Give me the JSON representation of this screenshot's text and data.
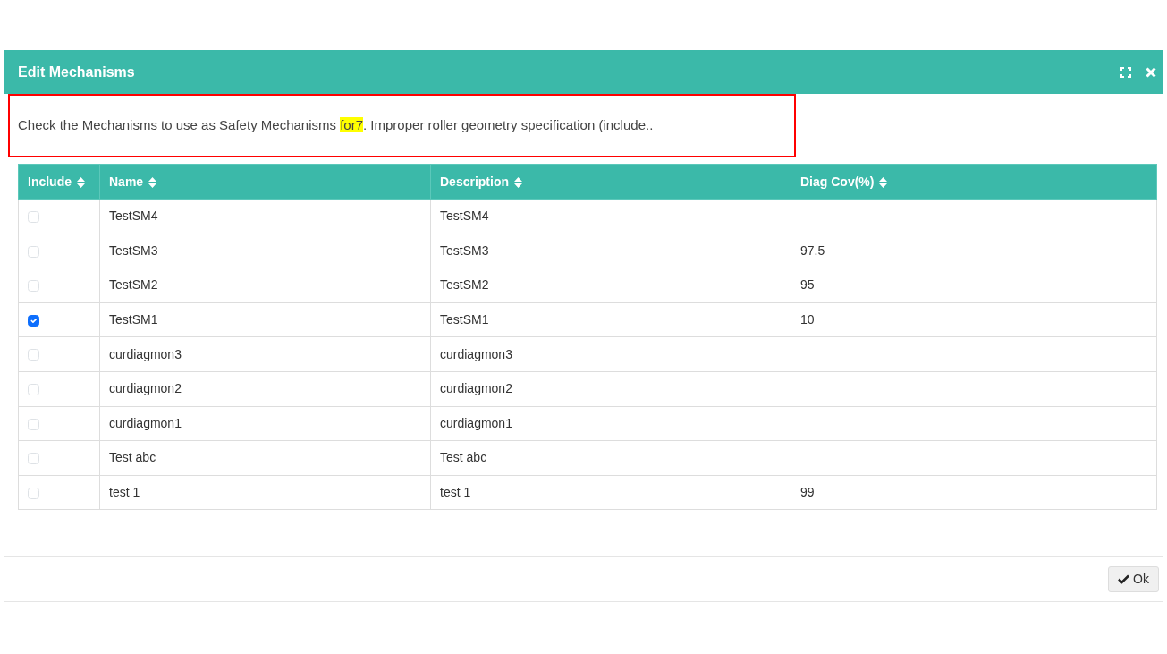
{
  "dialog": {
    "title": "Edit Mechanisms"
  },
  "message": [
    {
      "text": "Check the Mechanisms to use as Safety Mechanisms ",
      "highlighted": false
    },
    {
      "text": "for7",
      "highlighted": true
    },
    {
      "text": ". Improper roller geometry specification (include..",
      "highlighted": false
    }
  ],
  "table": {
    "columns": [
      "Include",
      "Name",
      "Description",
      "Diag Cov(%)"
    ],
    "rows": [
      {
        "checked": false,
        "name": "TestSM4",
        "description": "TestSM4",
        "diag_cov": ""
      },
      {
        "checked": false,
        "name": "TestSM3",
        "description": "TestSM3",
        "diag_cov": "97.5"
      },
      {
        "checked": false,
        "name": "TestSM2",
        "description": "TestSM2",
        "diag_cov": "95"
      },
      {
        "checked": true,
        "name": "TestSM1",
        "description": "TestSM1",
        "diag_cov": "10"
      },
      {
        "checked": false,
        "name": "curdiagmon3",
        "description": "curdiagmon3",
        "diag_cov": ""
      },
      {
        "checked": false,
        "name": "curdiagmon2",
        "description": "curdiagmon2",
        "diag_cov": ""
      },
      {
        "checked": false,
        "name": "curdiagmon1",
        "description": "curdiagmon1",
        "diag_cov": ""
      },
      {
        "checked": false,
        "name": "Test abc",
        "description": "Test abc",
        "diag_cov": ""
      },
      {
        "checked": false,
        "name": "test 1",
        "description": "test 1",
        "diag_cov": "99"
      }
    ]
  },
  "buttons": [
    {
      "label": "Ok"
    }
  ]
}
